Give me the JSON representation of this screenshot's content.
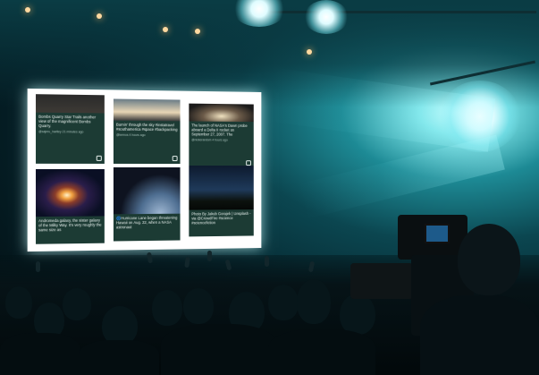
{
  "screen_posts": [
    {
      "text": "Bombs Quarry Star Trails another view of the magnificent Bombs Quarry.",
      "meta": "@sajeru_hartley\n21 minutes ago"
    },
    {
      "text": "Burnin' through the sky #instatravel #southamerica #space #backpacking",
      "meta": "@kernos\n4 hours ago"
    },
    {
      "text": "The launch of NASA's Dawn probe aboard a Delta II rocket on September 27, 2007. The",
      "meta": "@nickerandom\n4 hours ago"
    },
    {
      "text": "Andromeda galaxy, the sister galaxy of the Milky Way. It's very roughly the same size as",
      "meta": ""
    },
    {
      "text": "🌀Hurricane Lane began threatening Hawaii on Aug. 22, when a NASA astronaut",
      "meta": ""
    },
    {
      "text": "Photo By Jakub Gorajek | Unsplash - via @CrowdFire #science #sciencefiction",
      "meta": ""
    }
  ],
  "colors": {
    "card_bg": "#1c3b34",
    "screen_bg": "#ffffff",
    "stage_glow": "#7fe6ea"
  }
}
